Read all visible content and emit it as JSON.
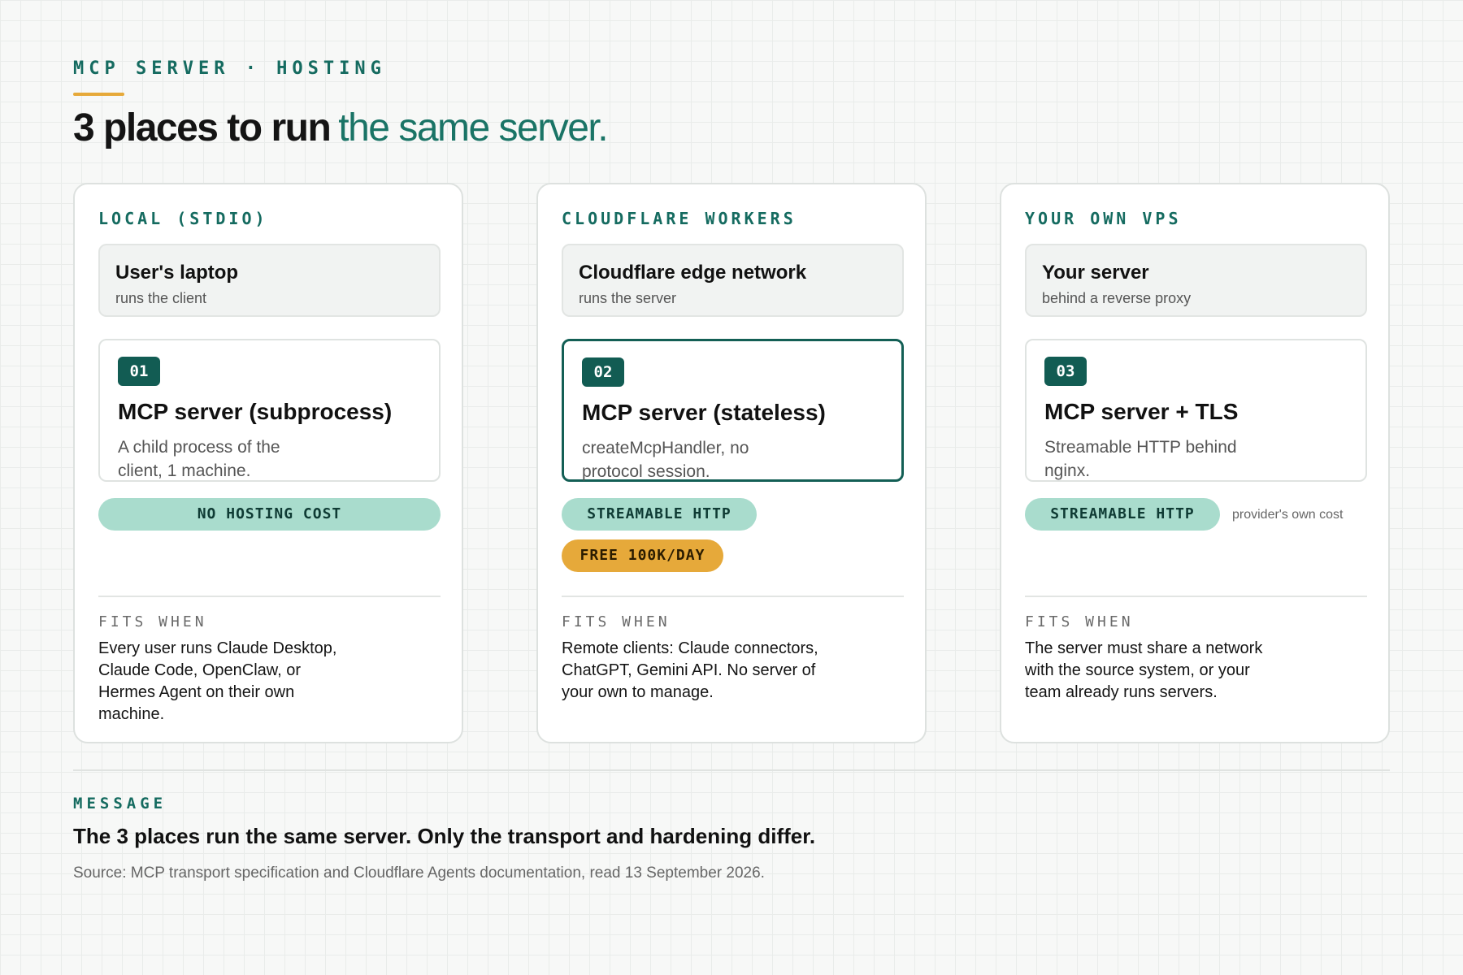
{
  "header": {
    "eyebrow": "MCP SERVER · HOSTING",
    "headline_dark": "3 places to run",
    "headline_accent": "the same server."
  },
  "cards": [
    {
      "title": "LOCAL (STDIO)",
      "host_name": "User's laptop",
      "host_sub": "runs the client",
      "number": "01",
      "server_title": "MCP server (subprocess)",
      "server_desc": "A child process of the client, 1 machine.",
      "pills": [
        "NO HOSTING COST"
      ],
      "side_note": "",
      "fits_label": "FITS WHEN",
      "fits_text": "Every user runs Claude Desktop, Claude Code, OpenClaw, or Hermes Agent on their own machine."
    },
    {
      "title": "CLOUDFLARE WORKERS",
      "host_name": "Cloudflare edge network",
      "host_sub": "runs the server",
      "number": "02",
      "server_title": "MCP server (stateless)",
      "server_desc": "createMcpHandler, no protocol session.",
      "pills": [
        "STREAMABLE HTTP",
        "FREE 100K/DAY"
      ],
      "side_note": "",
      "fits_label": "FITS WHEN",
      "fits_text": "Remote clients: Claude connectors, ChatGPT, Gemini API. No server of your own to manage."
    },
    {
      "title": "YOUR OWN VPS",
      "host_name": "Your server",
      "host_sub": "behind a reverse proxy",
      "number": "03",
      "server_title": "MCP server + TLS",
      "server_desc": "Streamable HTTP behind nginx.",
      "pills": [
        "STREAMABLE HTTP"
      ],
      "side_note": "provider's own cost",
      "fits_label": "FITS WHEN",
      "fits_text": "The server must share a network with the source system, or your team already runs servers."
    }
  ],
  "message": {
    "label": "MESSAGE",
    "text": "The 3 places run the same server. Only the transport and hardening differ.",
    "source": "Source: MCP transport specification and Cloudflare Agents documentation, read 13 September 2026."
  },
  "colors": {
    "accent": "#156b60",
    "badge": "#125c53",
    "pill_teal": "#a9dccd",
    "pill_amber": "#e6a93a"
  }
}
